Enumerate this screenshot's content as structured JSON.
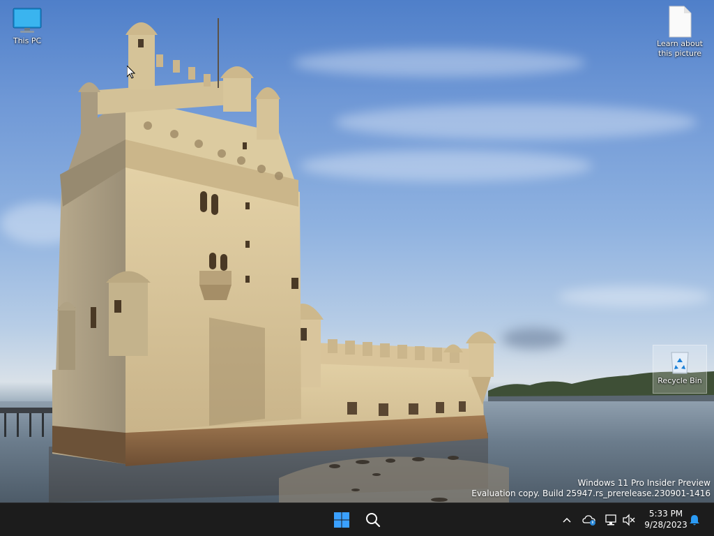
{
  "desktop": {
    "icons": [
      {
        "id": "this-pc",
        "label": "This PC"
      },
      {
        "id": "learn-picture",
        "label": "Learn about this picture"
      },
      {
        "id": "recycle-bin",
        "label": "Recycle Bin"
      }
    ],
    "watermark": {
      "line1": "Windows 11 Pro Insider Preview",
      "line2": "Evaluation copy. Build 25947.rs_prerelease.230901-1416"
    }
  },
  "taskbar": {
    "buttons": [
      {
        "name": "start-button",
        "icon": "windows-logo-icon"
      },
      {
        "name": "search-button",
        "icon": "search-icon"
      }
    ],
    "tray": {
      "icons": [
        "chevron-up-icon",
        "onedrive-cloud-icon",
        "network-icon",
        "volume-muted-icon",
        "notification-bell-icon"
      ],
      "time": "5:33 PM",
      "date": "9/28/2023"
    }
  },
  "colors": {
    "taskbar": "#1c1c1c",
    "accent": "#0078d4",
    "start_logo": "#3aa0ff"
  }
}
